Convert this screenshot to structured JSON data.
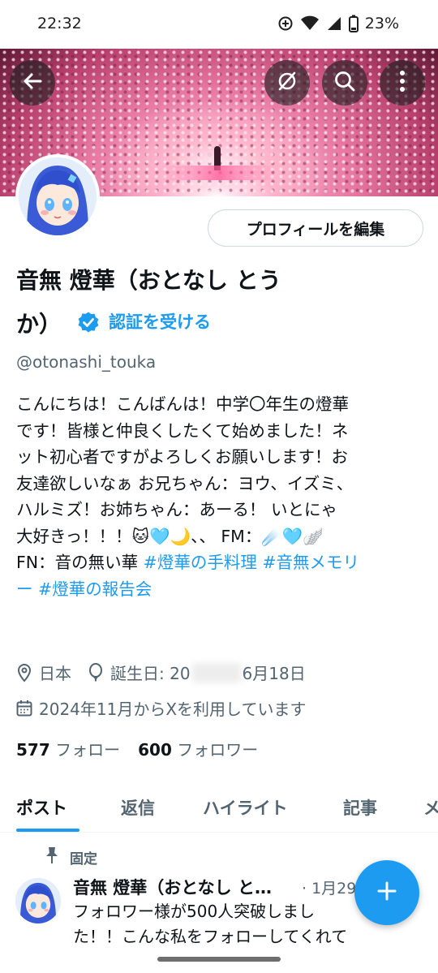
{
  "status_bar": {
    "time": "22:32",
    "battery": "23%",
    "icons": [
      "data-saver-icon",
      "wifi-icon",
      "signal-icon",
      "battery-icon"
    ]
  },
  "header": {
    "back_icon": "arrow-left-icon",
    "incognito_icon": "circle-slash-icon",
    "search_icon": "search-icon",
    "more_icon": "more-vertical-icon"
  },
  "profile": {
    "edit_button": "プロフィールを編集",
    "name_line1": "音無 燈華（おとなし とう",
    "name_line2": "か）",
    "verify_label": "認証を受ける",
    "handle": "@otonashi_touka",
    "bio_lines": [
      "こんにちは！こんばんは！中学〇年生の燈華",
      "です！皆様と仲良くしたくて始めました！ネ",
      "ット初心者ですがよろしくお願いします！お",
      "友達欲しいなぁ お兄ちゃん：ヨウ、イズミ、",
      "ハルミズ！お姉ちゃん：あーる！ いとにゃ",
      "大好きっ！！！🐱🩵🌙、、 FM：☄️🩵🪽"
    ],
    "bio_fn": "FN：音の無い華 ",
    "bio_hashtag1": "#燈華の手料理",
    "bio_hashtag2": "#音無メモリ",
    "bio_hashtag2_cont": "ー",
    "bio_hashtag3": "#燈華の報告会",
    "location": "日本",
    "birthday_prefix": "誕生日: 20",
    "birthday_suffix": "6月18日",
    "joined": "2024年11月からXを利用しています",
    "following_count": "577",
    "following_label": "フォロー",
    "followers_count": "600",
    "followers_label": "フォロワー"
  },
  "tabs": [
    {
      "label": "ポスト",
      "active": true
    },
    {
      "label": "返信",
      "active": false
    },
    {
      "label": "ハイライト",
      "active": false
    },
    {
      "label": "記事",
      "active": false
    },
    {
      "label": "メ",
      "active": false
    }
  ],
  "pinned_post": {
    "pinned_label": "固定",
    "name": "音無 燈華（おとなし と…",
    "date": "· 1月29",
    "text_lines": [
      "フォロワー様が500人突破しまし",
      "た！！こんな私をフォローしてくれて"
    ]
  },
  "colors": {
    "accent": "#1d9bf0",
    "text": "#0f1419",
    "secondary": "#536471"
  }
}
